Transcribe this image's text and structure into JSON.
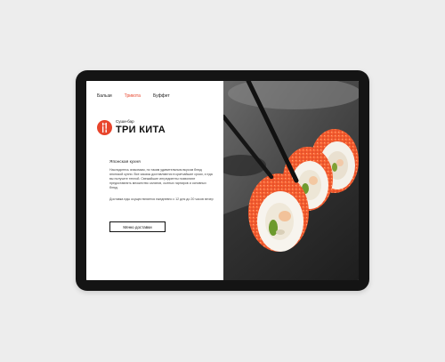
{
  "nav": {
    "items": [
      {
        "label": "Бальзи"
      },
      {
        "label": "Трикота"
      },
      {
        "label": "Буффет"
      }
    ],
    "active_index": 1
  },
  "brand": {
    "small": "Суши-бар",
    "name": "ТРИ КИТА"
  },
  "content": {
    "title": "Японская кухня",
    "paragraph1": "Насладитесь знакомым, но таким удивительным вкусом блюд японской кухни. Все заказы доставляются в кратчайшие сроки, и еда вы получите теплой. Свежайшие ингредиенты позволяют предоставлять множество салатов, сытных гарниров и основных блюд.",
    "paragraph2": "Доставка еды осуществляется ежедневно с 12 для до 20 часов вечер",
    "button_label": "Меню доставки"
  },
  "colors": {
    "accent": "#e8452c",
    "tablet_frame": "#141414",
    "background": "#ededed"
  }
}
